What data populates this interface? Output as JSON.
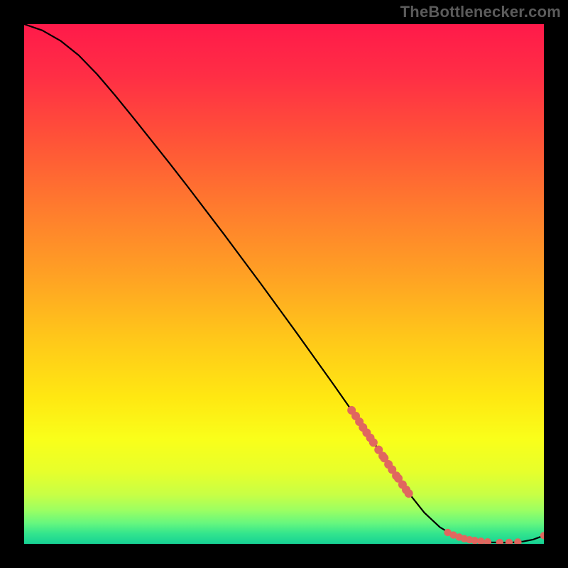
{
  "watermark": "TheBottleneсker.com",
  "chart_data": {
    "type": "line",
    "title": "",
    "xlabel": "",
    "ylabel": "",
    "xlim": [
      0,
      100
    ],
    "ylim": [
      0,
      100
    ],
    "legend": false,
    "grid": false,
    "background_gradient": {
      "stops": [
        {
          "offset": 0.0,
          "color": "#ff1a4a"
        },
        {
          "offset": 0.1,
          "color": "#ff2e45"
        },
        {
          "offset": 0.22,
          "color": "#ff5238"
        },
        {
          "offset": 0.35,
          "color": "#ff7a2e"
        },
        {
          "offset": 0.48,
          "color": "#ffa024"
        },
        {
          "offset": 0.6,
          "color": "#ffc61a"
        },
        {
          "offset": 0.72,
          "color": "#ffe812"
        },
        {
          "offset": 0.8,
          "color": "#f9ff1a"
        },
        {
          "offset": 0.86,
          "color": "#e7ff2b"
        },
        {
          "offset": 0.905,
          "color": "#c8ff45"
        },
        {
          "offset": 0.935,
          "color": "#9cff62"
        },
        {
          "offset": 0.96,
          "color": "#66f77e"
        },
        {
          "offset": 0.98,
          "color": "#33e58d"
        },
        {
          "offset": 1.0,
          "color": "#16d294"
        }
      ]
    },
    "series": [
      {
        "name": "curve",
        "x": [
          0.0,
          3.5,
          7.0,
          10.5,
          14.0,
          17.5,
          21.0,
          24.5,
          28.0,
          31.5,
          35.0,
          38.5,
          42.0,
          45.5,
          49.0,
          52.5,
          56.0,
          59.5,
          63.0,
          66.5,
          70.0,
          73.5,
          77.0,
          80.0,
          82.5,
          85.0,
          87.5,
          90.0,
          92.0,
          94.0,
          96.0,
          98.0,
          100.0
        ],
        "y": [
          100.0,
          98.8,
          96.8,
          94.0,
          90.4,
          86.3,
          82.0,
          77.6,
          73.2,
          68.7,
          64.1,
          59.5,
          54.8,
          50.1,
          45.3,
          40.5,
          35.6,
          30.7,
          25.7,
          20.6,
          15.5,
          10.4,
          6.0,
          3.2,
          1.7,
          0.9,
          0.5,
          0.3,
          0.25,
          0.28,
          0.45,
          0.85,
          1.6
        ]
      }
    ],
    "markers": {
      "name": "highlight-points",
      "color": "#e0675f",
      "radius_default": 6.0,
      "points": [
        {
          "x": 63.0,
          "y": 25.7
        },
        {
          "x": 63.8,
          "y": 24.6
        },
        {
          "x": 64.5,
          "y": 23.5
        },
        {
          "x": 65.2,
          "y": 22.4
        },
        {
          "x": 65.9,
          "y": 21.4
        },
        {
          "x": 66.6,
          "y": 20.4
        },
        {
          "x": 67.2,
          "y": 19.5
        },
        {
          "x": 68.2,
          "y": 18.1
        },
        {
          "x": 69.0,
          "y": 16.9
        },
        {
          "x": 69.3,
          "y": 16.5
        },
        {
          "x": 70.1,
          "y": 15.3
        },
        {
          "x": 70.8,
          "y": 14.3
        },
        {
          "x": 71.6,
          "y": 13.1
        },
        {
          "x": 72.0,
          "y": 12.6
        },
        {
          "x": 72.8,
          "y": 11.4
        },
        {
          "x": 73.5,
          "y": 10.4
        },
        {
          "x": 74.0,
          "y": 9.7
        },
        {
          "x": 81.5,
          "y": 2.2,
          "r": 5.2
        },
        {
          "x": 82.6,
          "y": 1.7,
          "r": 5.2
        },
        {
          "x": 83.7,
          "y": 1.3,
          "r": 5.2
        },
        {
          "x": 84.7,
          "y": 1.0,
          "r": 5.2
        },
        {
          "x": 85.7,
          "y": 0.8,
          "r": 5.2
        },
        {
          "x": 86.7,
          "y": 0.65,
          "r": 5.2
        },
        {
          "x": 87.9,
          "y": 0.5,
          "r": 5.2
        },
        {
          "x": 89.2,
          "y": 0.38,
          "r": 5.2
        },
        {
          "x": 91.5,
          "y": 0.27,
          "r": 5.2
        },
        {
          "x": 93.3,
          "y": 0.28,
          "r": 5.2
        },
        {
          "x": 95.0,
          "y": 0.35,
          "r": 5.2
        },
        {
          "x": 100.0,
          "y": 1.6,
          "r": 5.2
        }
      ]
    }
  }
}
